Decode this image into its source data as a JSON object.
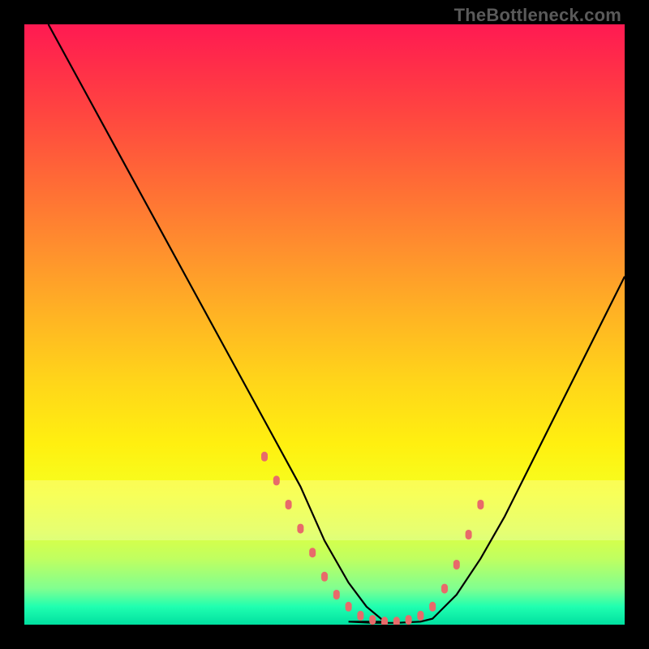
{
  "branding": {
    "source_label": "TheBottleneck.com"
  },
  "colors": {
    "page_bg": "#000000",
    "curve_stroke": "#000000",
    "dot_fill": "#e86a6a",
    "title_color": "#5a5a5a",
    "gradient_stops": [
      "#ff1a52",
      "#ff2b4a",
      "#ff4640",
      "#ff6a36",
      "#ff8e2e",
      "#ffb224",
      "#ffd41a",
      "#fff010",
      "#f6ff20",
      "#e0ff40",
      "#c0ff60",
      "#80ff90",
      "#20ffb0",
      "#00e0a0"
    ]
  },
  "chart_data": {
    "type": "line",
    "title": "",
    "xlabel": "",
    "ylabel": "",
    "xlim": [
      0,
      100
    ],
    "ylim": [
      0,
      100
    ],
    "grid": false,
    "legend": false,
    "series": [
      {
        "name": "left_arm",
        "x": [
          4,
          10,
          16,
          22,
          28,
          34,
          40,
          46,
          50,
          54,
          57,
          60
        ],
        "y": [
          100,
          89,
          78,
          67,
          56,
          45,
          34,
          23,
          14,
          7,
          3,
          0.5
        ]
      },
      {
        "name": "valley_floor",
        "x": [
          54,
          58,
          62,
          66,
          68
        ],
        "y": [
          0.5,
          0.3,
          0.3,
          0.5,
          1
        ]
      },
      {
        "name": "right_arm",
        "x": [
          68,
          72,
          76,
          80,
          84,
          88,
          92,
          96,
          100
        ],
        "y": [
          1,
          5,
          11,
          18,
          26,
          34,
          42,
          50,
          58
        ]
      }
    ],
    "highlight_points": {
      "name": "dotted_segments",
      "x": [
        40,
        42,
        44,
        46,
        48,
        50,
        52,
        54,
        56,
        58,
        60,
        62,
        64,
        66,
        68,
        70,
        72,
        74,
        76
      ],
      "y": [
        28,
        24,
        20,
        16,
        12,
        8,
        5,
        3,
        1.5,
        0.8,
        0.5,
        0.5,
        0.8,
        1.5,
        3,
        6,
        10,
        15,
        20
      ]
    },
    "pale_bands_y": [
      [
        18,
        24
      ],
      [
        14,
        18
      ]
    ]
  }
}
